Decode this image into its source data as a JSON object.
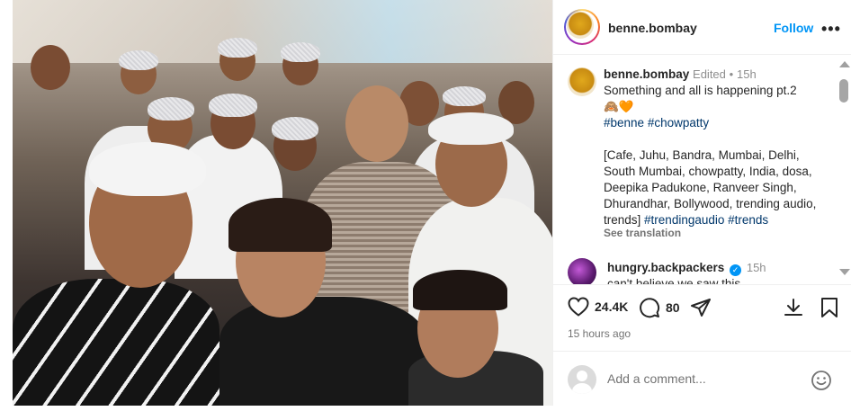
{
  "post": {
    "username": "benne.bombay",
    "follow_label": "Follow",
    "more_label": "•••"
  },
  "caption": {
    "username": "benne.bombay",
    "edited": "Edited",
    "dot": "•",
    "time": "15h",
    "line1": "Something and all is happening pt.2",
    "emojis": "🙈🧡",
    "hashtags": [
      "#benne",
      "#chowpatty"
    ],
    "keywords": "[Cafe, Juhu, Bandra, Mumbai, Delhi, South Mumbai, chowpatty, India, dosa, Deepika Padukone, Ranveer Singh, Dhurandhar, Bollywood, trending audio, trends]",
    "trailing_tags": [
      "#trendingaudio",
      "#trends"
    ],
    "see_translation": "See translation"
  },
  "comment": {
    "username": "hungry.backpackers",
    "time": "15h",
    "text": "can't believe we saw this"
  },
  "actions": {
    "likes": "24.4K",
    "comments": "80",
    "time_ago": "15 hours ago"
  },
  "add_comment": {
    "placeholder": "Add a comment..."
  },
  "icons": [
    "heart-icon",
    "comment-icon",
    "share-icon",
    "download-icon",
    "bookmark-icon",
    "emoji-icon",
    "verified-icon"
  ],
  "colors": {
    "accent": "#0095f6",
    "hashtag": "#00376b",
    "muted": "#737373"
  }
}
